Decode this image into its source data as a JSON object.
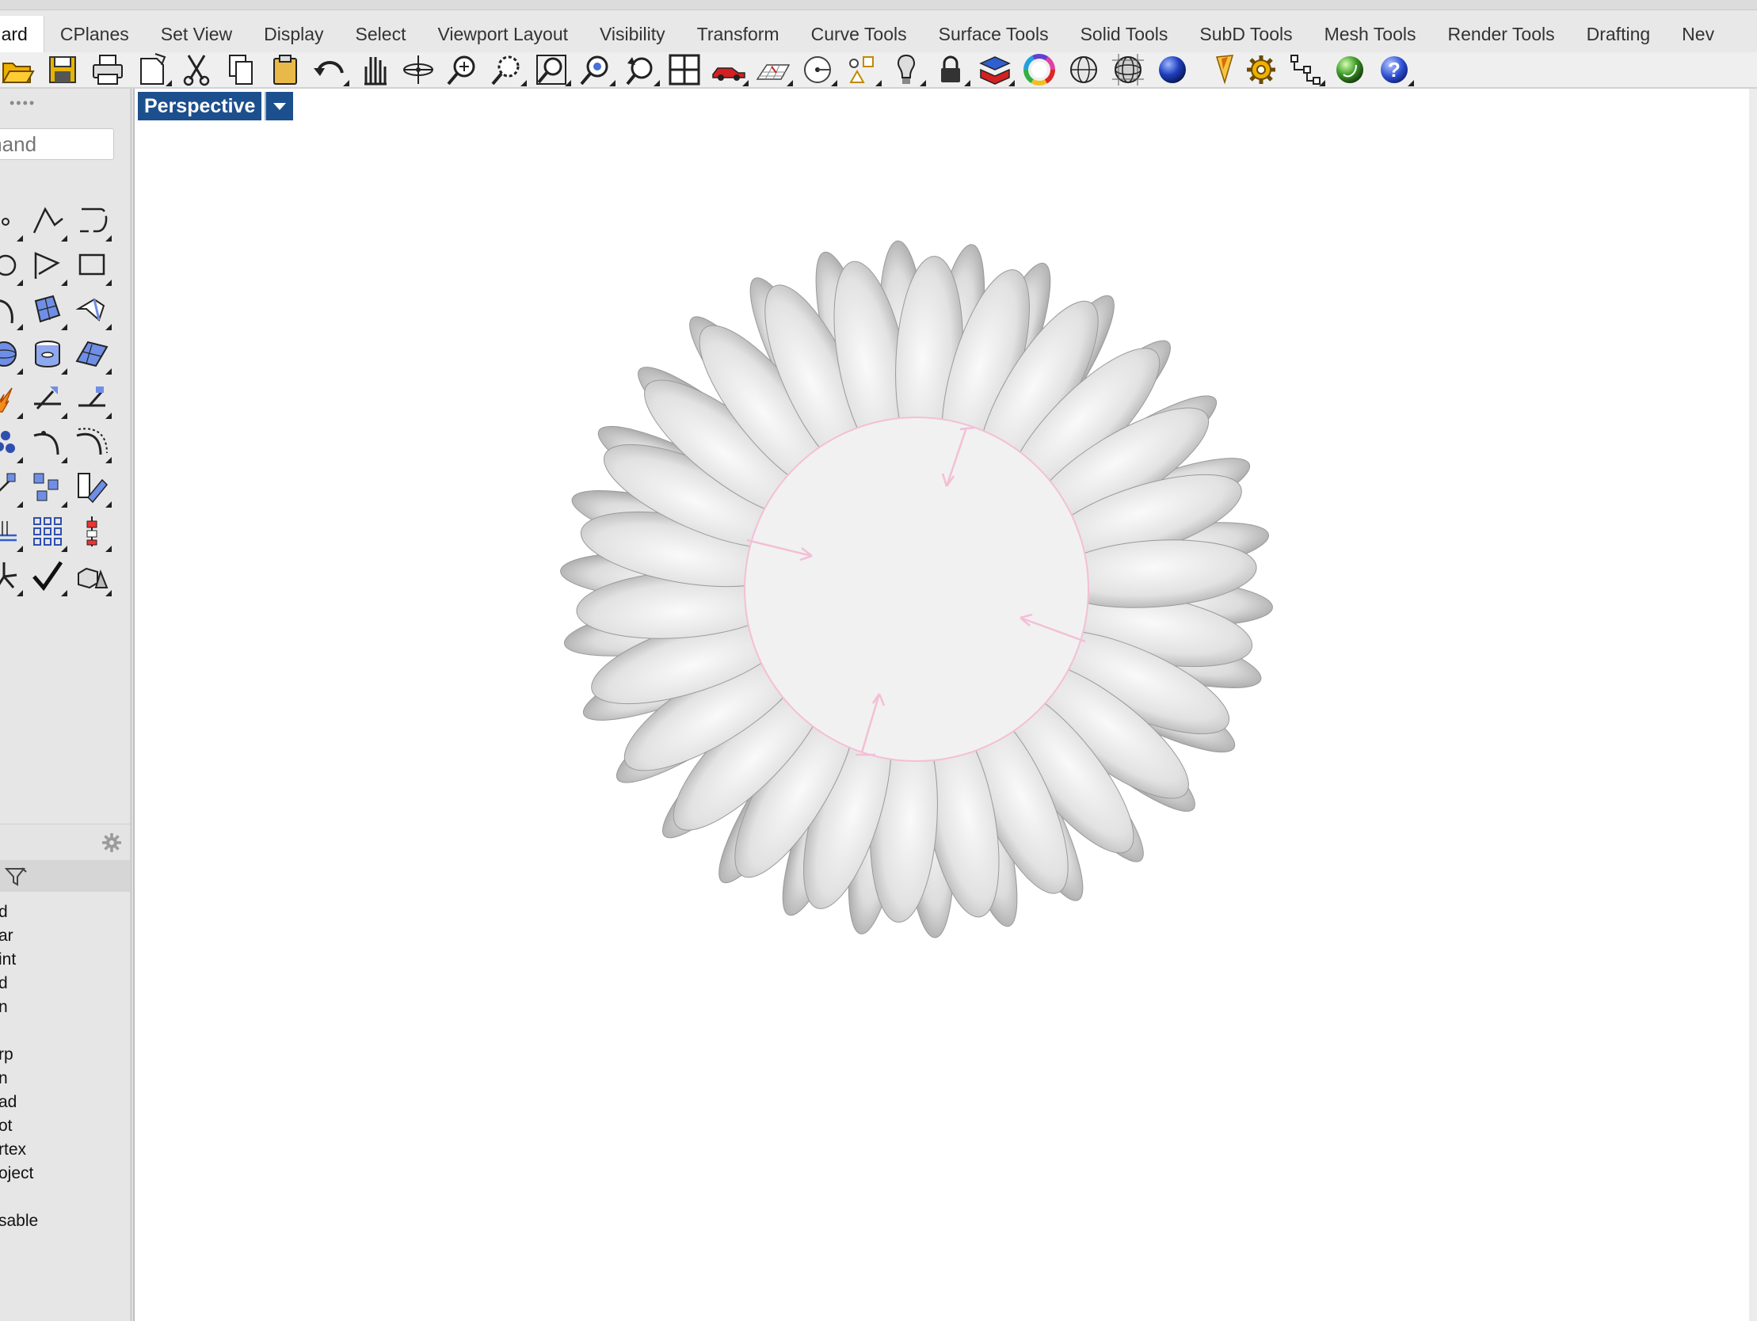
{
  "tabs": {
    "active": "ndard",
    "items": [
      "CPlanes",
      "Set View",
      "Display",
      "Select",
      "Viewport Layout",
      "Visibility",
      "Transform",
      "Curve Tools",
      "Surface Tools",
      "Solid Tools",
      "SubD Tools",
      "Mesh Tools",
      "Render Tools",
      "Drafting",
      "Nev"
    ]
  },
  "toolbar": {
    "icons": [
      "open-icon",
      "save-icon",
      "print-icon",
      "import-icon",
      "cut-icon",
      "copy-icon",
      "paste-icon",
      "undo-icon",
      "pan-icon",
      "rotate-view-icon",
      "zoom-icon",
      "zoom-window-icon",
      "zoom-extents-icon",
      "zoom-selected-icon",
      "undo-view-icon",
      "four-viewports-icon",
      "car-icon",
      "grid-icon",
      "named-cplane-icon",
      "shapes-icon",
      "light-bulb-icon",
      "lock-icon",
      "layer-icon",
      "color-wheel-icon",
      "wireframe-sphere-icon",
      "mesh-sphere-icon",
      "blue-sphere-icon",
      "flag-icon",
      "gear-icon",
      "tree-icon",
      "render-sphere-icon",
      "help-icon"
    ]
  },
  "left_panel": {
    "grip": "••••",
    "command_placeholder": "mand",
    "tools": [
      "point-icon",
      "polyline-icon",
      "curve-icon",
      "circle-icon",
      "arc-polyline-icon",
      "rectangle-icon",
      "arc-icon",
      "surface-icon",
      "edge-surface-icon",
      "sphere-icon",
      "cylinder-icon",
      "plane-surface-icon",
      "boolean-icon",
      "split-icon",
      "trim-icon",
      "group-icon",
      "fillet-icon",
      "offset-icon",
      "move-icon",
      "array-icon",
      "edit-icon",
      "layout-icon",
      "grid-array-icon",
      "gumball-icon",
      "fan-icon",
      "check-icon",
      "solid-icon"
    ],
    "osnaps": [
      "d",
      "ar",
      "int",
      "d",
      "n",
      "rp",
      "n",
      "ad",
      "ot",
      "rtex",
      "oject",
      "sable"
    ]
  },
  "viewport": {
    "name": "Perspective"
  },
  "colors": {
    "viewport_label_bg": "#1c4f8d",
    "circle_outline": "#f4bfd6"
  }
}
